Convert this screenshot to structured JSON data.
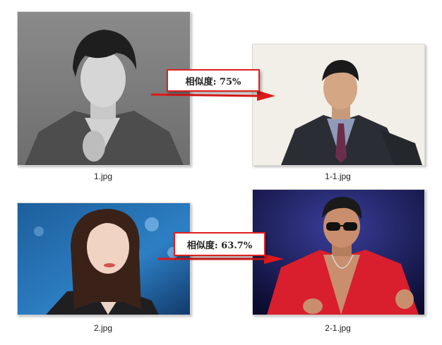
{
  "files": [
    {
      "name": "1.jpg"
    },
    {
      "name": "1-1.jpg"
    },
    {
      "name": "2.jpg"
    },
    {
      "name": "2-1.jpg"
    }
  ],
  "comparisons": [
    {
      "label": "相似度: 75%",
      "from": "1.jpg",
      "to": "1-1.jpg"
    },
    {
      "label": "相似度: 63.7%",
      "from": "2.jpg",
      "to": "2-1.jpg"
    }
  ],
  "colors": {
    "accent": "#e02020",
    "label_border": "#e02020",
    "arrow": "#dd1a1a"
  }
}
